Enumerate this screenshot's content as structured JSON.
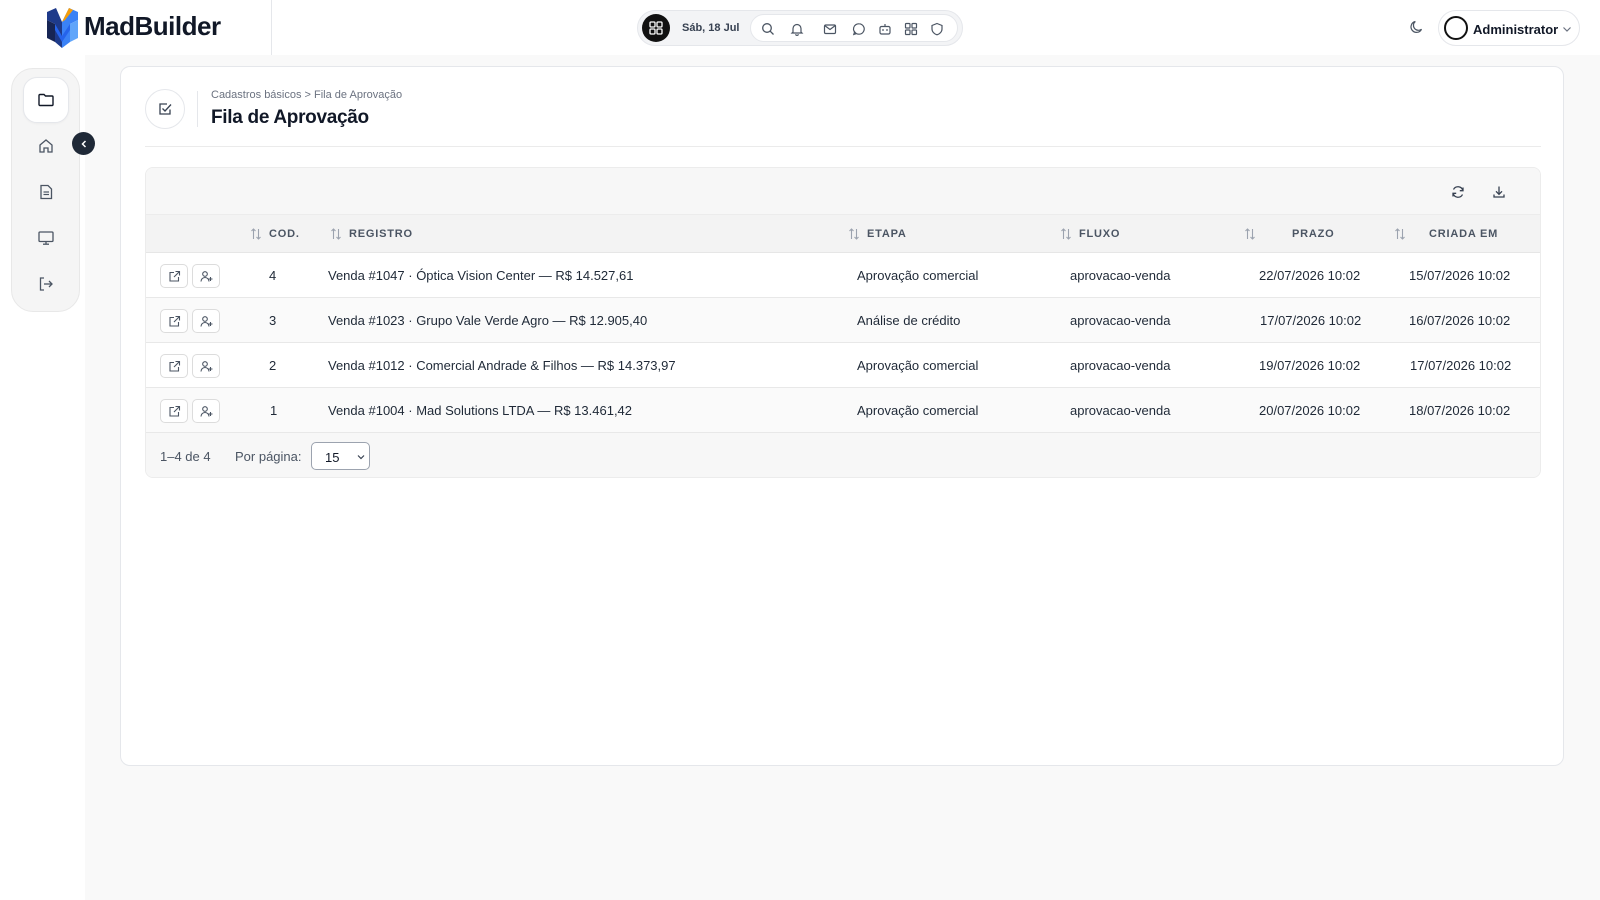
{
  "brand": {
    "name": "MadBuilder",
    "colors": {
      "m_left": "#1e3a8a",
      "m_right": "#3b82f6",
      "m_accent": "#f59e0b"
    }
  },
  "topbar": {
    "date": "Sáb, 18 Jul",
    "icons": [
      "search-icon",
      "bell-icon",
      "mail-icon",
      "chat-icon",
      "robot-icon",
      "grid-icon",
      "shield-icon"
    ],
    "user": "Administrator"
  },
  "sidebar": {
    "items": [
      "folder-icon",
      "home-icon",
      "document-icon",
      "monitor-icon",
      "logout-icon"
    ],
    "active": 0
  },
  "page": {
    "breadcrumb": "Cadastros básicos > Fila de Aprovação",
    "title": "Fila de Aprovação"
  },
  "table": {
    "columns": {
      "cod": "COD.",
      "registro": "REGISTRO",
      "etapa": "ETAPA",
      "fluxo": "FLUXO",
      "prazo": "PRAZO",
      "criada": "CRIADA EM"
    },
    "rows": [
      {
        "cod": "4",
        "registro": "Venda #1047 · Óptica Vision Center — R$ 14.527,61",
        "etapa": "Aprovação comercial",
        "fluxo": "aprovacao-venda",
        "prazo": "22/07/2026 10:02",
        "criada": "15/07/2026 10:02"
      },
      {
        "cod": "3",
        "registro": "Venda #1023 · Grupo Vale Verde Agro — R$ 12.905,40",
        "etapa": "Análise de crédito",
        "fluxo": "aprovacao-venda",
        "prazo": "17/07/2026 10:02",
        "criada": "16/07/2026 10:02"
      },
      {
        "cod": "2",
        "registro": "Venda #1012 · Comercial Andrade & Filhos — R$ 14.373,97",
        "etapa": "Aprovação comercial",
        "fluxo": "aprovacao-venda",
        "prazo": "19/07/2026 10:02",
        "criada": "17/07/2026 10:02"
      },
      {
        "cod": "1",
        "registro": "Venda #1004 · Mad Solutions LTDA — R$ 13.461,42",
        "etapa": "Aprovação comercial",
        "fluxo": "aprovacao-venda",
        "prazo": "20/07/2026 10:02",
        "criada": "18/07/2026 10:02"
      }
    ],
    "footer": {
      "range": "1–4 de 4",
      "per_page_label": "Por página:",
      "per_page_value": "15"
    }
  }
}
